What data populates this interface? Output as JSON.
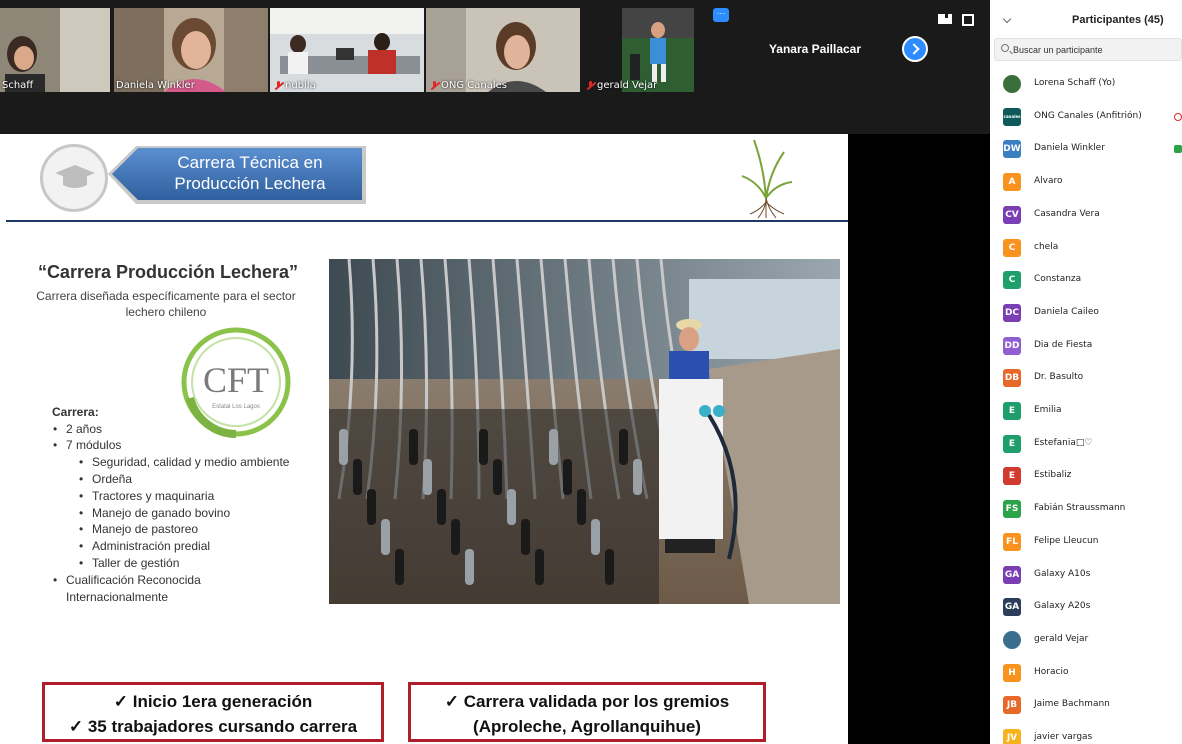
{
  "video_strip": {
    "tiles": [
      {
        "name": "Schaff",
        "muted": false,
        "bg": "#8a8070"
      },
      {
        "name": "Daniela Winkler",
        "muted": false,
        "bg": "#9b8a78"
      },
      {
        "name": "nubila",
        "muted": true,
        "bg": "#7a7f86"
      },
      {
        "name": "ONG Canales",
        "muted": true,
        "bg": "#b7b0a6"
      },
      {
        "name": "gerald Vejar",
        "muted": true,
        "bg": "#2f5b3a"
      },
      {
        "name": "",
        "muted": true,
        "bg": "#1a1a1a"
      }
    ],
    "active_speaker_name": "Yanara Paillacar",
    "more_label": "···"
  },
  "slide": {
    "banner_title_line1": "Carrera Técnica en",
    "banner_title_line2": "Producción Lechera",
    "heading": "“Carrera Producción Lechera”",
    "subheading_line1": "Carrera diseñada específicamente para el sector",
    "subheading_line2": "lechero chileno",
    "logo_text": "CFT",
    "logo_subtext": "Estatal Los Lagos",
    "list_title": "Carrera:",
    "list": [
      {
        "text": "2 años",
        "level": 1
      },
      {
        "text": "7 módulos",
        "level": 1
      },
      {
        "text": "Seguridad, calidad y medio ambiente",
        "level": 2
      },
      {
        "text": "Ordeña",
        "level": 2
      },
      {
        "text": "Tractores y maquinaria",
        "level": 2
      },
      {
        "text": "Manejo de ganado bovino",
        "level": 2
      },
      {
        "text": "Manejo de pastoreo",
        "level": 2
      },
      {
        "text": "Administración predial",
        "level": 2
      },
      {
        "text": "Taller de gestión",
        "level": 2
      },
      {
        "text": "Cualificación Reconocida",
        "level": 1
      },
      {
        "text": "Internacionalmente",
        "level": 0
      }
    ],
    "box1_line1": "✓  Inicio 1era generación",
    "box1_line2": "✓  35 trabajadores cursando carrera",
    "box2_line1": "✓  Carrera validada por los gremios",
    "box2_line2": "(Aproleche, Agrollanquihue)"
  },
  "participants": {
    "title": "Participantes (45)",
    "search_placeholder": "Buscar un participante",
    "list": [
      {
        "initials": "",
        "name": "Lorena Schaff (Yo)",
        "color": "#3a6e3a",
        "photo": true
      },
      {
        "initials": "canales",
        "name": "ONG Canales (Anfitrión)",
        "color": "#0e5a5a",
        "photo": true
      },
      {
        "initials": "DW",
        "name": "Daniela Winkler",
        "color": "#3a7fc0",
        "photo": false
      },
      {
        "initials": "A",
        "name": "Alvaro",
        "color": "#f7931e",
        "photo": false
      },
      {
        "initials": "CV",
        "name": "Casandra Vera",
        "color": "#7b3fb5",
        "photo": false
      },
      {
        "initials": "C",
        "name": "chela",
        "color": "#f7931e",
        "photo": false
      },
      {
        "initials": "C",
        "name": "Constanza",
        "color": "#1e9e6a",
        "photo": false
      },
      {
        "initials": "DC",
        "name": "Daniela Caileo",
        "color": "#7b3fb5",
        "photo": false
      },
      {
        "initials": "DD",
        "name": "Dia de Fiesta",
        "color": "#8f5fd0",
        "photo": false
      },
      {
        "initials": "DB",
        "name": "Dr. Basulto",
        "color": "#e8682a",
        "photo": false
      },
      {
        "initials": "E",
        "name": "Emilia",
        "color": "#1e9e6a",
        "photo": false
      },
      {
        "initials": "E",
        "name": "Estefania□♡",
        "color": "#1e9e6a",
        "photo": false
      },
      {
        "initials": "E",
        "name": "Estibaliz",
        "color": "#d23b30",
        "photo": false
      },
      {
        "initials": "FS",
        "name": "Fabián Straussmann",
        "color": "#2aa34a",
        "photo": false
      },
      {
        "initials": "FL",
        "name": "Felipe Lleucun",
        "color": "#f7931e",
        "photo": false
      },
      {
        "initials": "GA",
        "name": "Galaxy A10s",
        "color": "#7b3fb5",
        "photo": false
      },
      {
        "initials": "GA",
        "name": "Galaxy A20s",
        "color": "#2d3e5a",
        "photo": false
      },
      {
        "initials": "",
        "name": "gerald Vejar",
        "color": "#3a6e8f",
        "photo": true
      },
      {
        "initials": "H",
        "name": "Horacio",
        "color": "#f7931e",
        "photo": false
      },
      {
        "initials": "JB",
        "name": "Jaime Bachmann",
        "color": "#e8682a",
        "photo": false
      },
      {
        "initials": "JV",
        "name": "javier vargas",
        "color": "#f7b21e",
        "photo": false
      }
    ]
  },
  "colors": {
    "zoom_blue": "#2d8cff",
    "banner_blue": "#3e73b8",
    "box_red": "#b01e2a",
    "cft_green": "#7cb342"
  }
}
